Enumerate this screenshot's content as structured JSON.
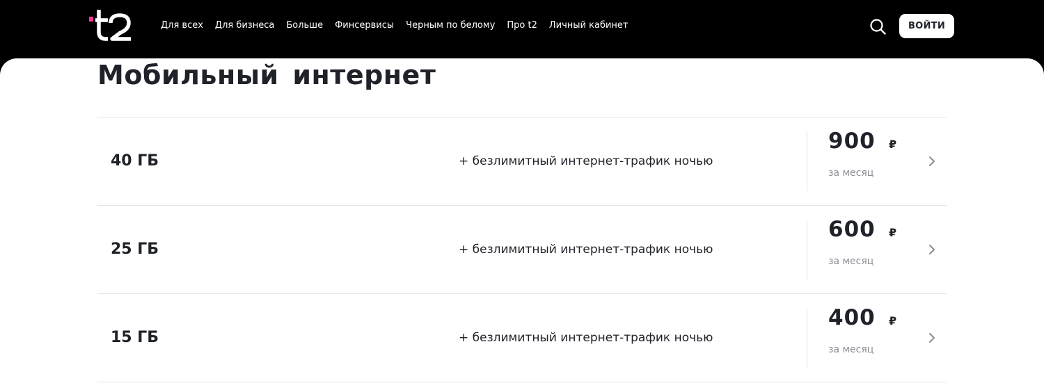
{
  "header": {
    "logo_text": "t2",
    "nav": [
      "Для всех",
      "Для бизнеса",
      "Больше",
      "Финсервисы",
      "Черным по белому",
      "Про t2",
      "Личный кабинет"
    ],
    "search_icon": "search-icon",
    "login_label": "ВОЙТИ"
  },
  "colors": {
    "header_bg": "#000000",
    "brand_accent": "#ff3495",
    "text_dark": "#1f2229",
    "text_muted": "#8a8d93",
    "divider": "#e2e3e6"
  },
  "main": {
    "title": "Мобильный интернет",
    "tariffs": [
      {
        "volume": "40 ГБ",
        "feature": "+ безлимитный интернет-трафик ночью",
        "price": "900",
        "currency": "₽",
        "period": "за месяц"
      },
      {
        "volume": "25 ГБ",
        "feature": "+ безлимитный интернет-трафик ночью",
        "price": "600",
        "currency": "₽",
        "period": "за месяц"
      },
      {
        "volume": "15 ГБ",
        "feature": "+ безлимитный интернет-трафик ночью",
        "price": "400",
        "currency": "₽",
        "period": "за месяц"
      }
    ],
    "row_icon": "chevron-right-icon"
  }
}
